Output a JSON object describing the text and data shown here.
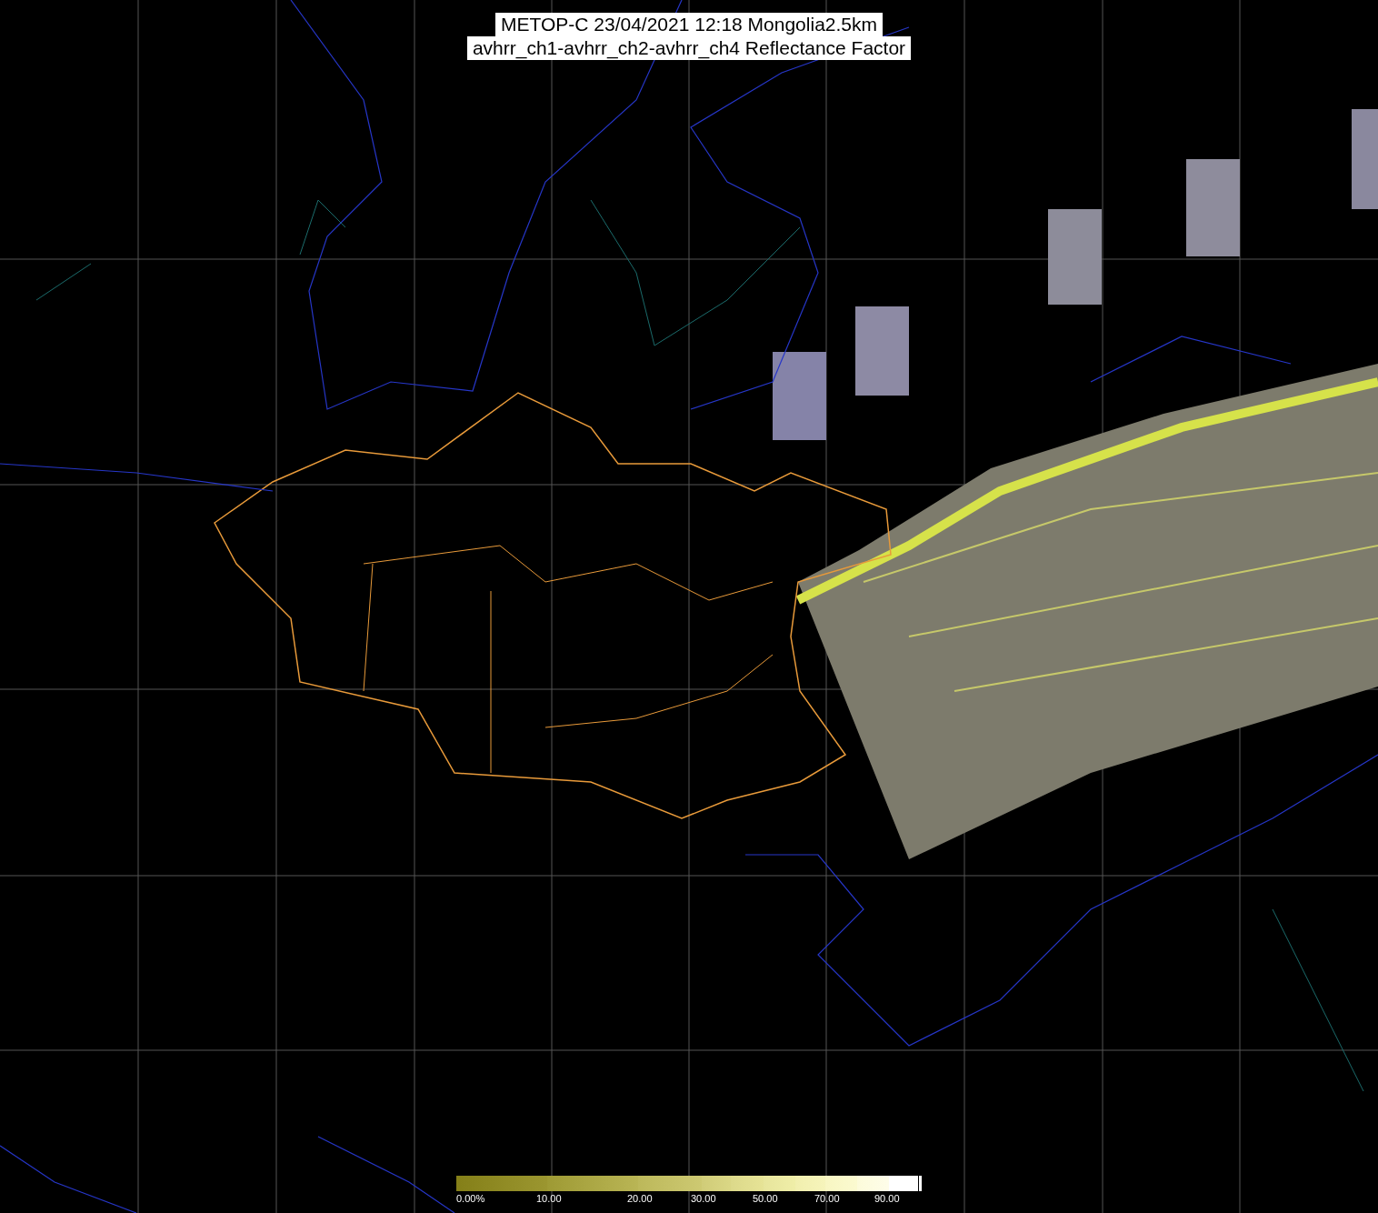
{
  "title": {
    "lines": [
      "METOP-C 23/04/2021 12:18 Mongolia2.5km",
      "avhrr_ch1-avhrr_ch2-avhrr_ch4 Reflectance Factor"
    ]
  },
  "colorbar": {
    "labels": [
      "0.00%",
      "10.00",
      "20.00",
      "30.00",
      "50.00",
      "70.00",
      "90.00"
    ]
  }
}
